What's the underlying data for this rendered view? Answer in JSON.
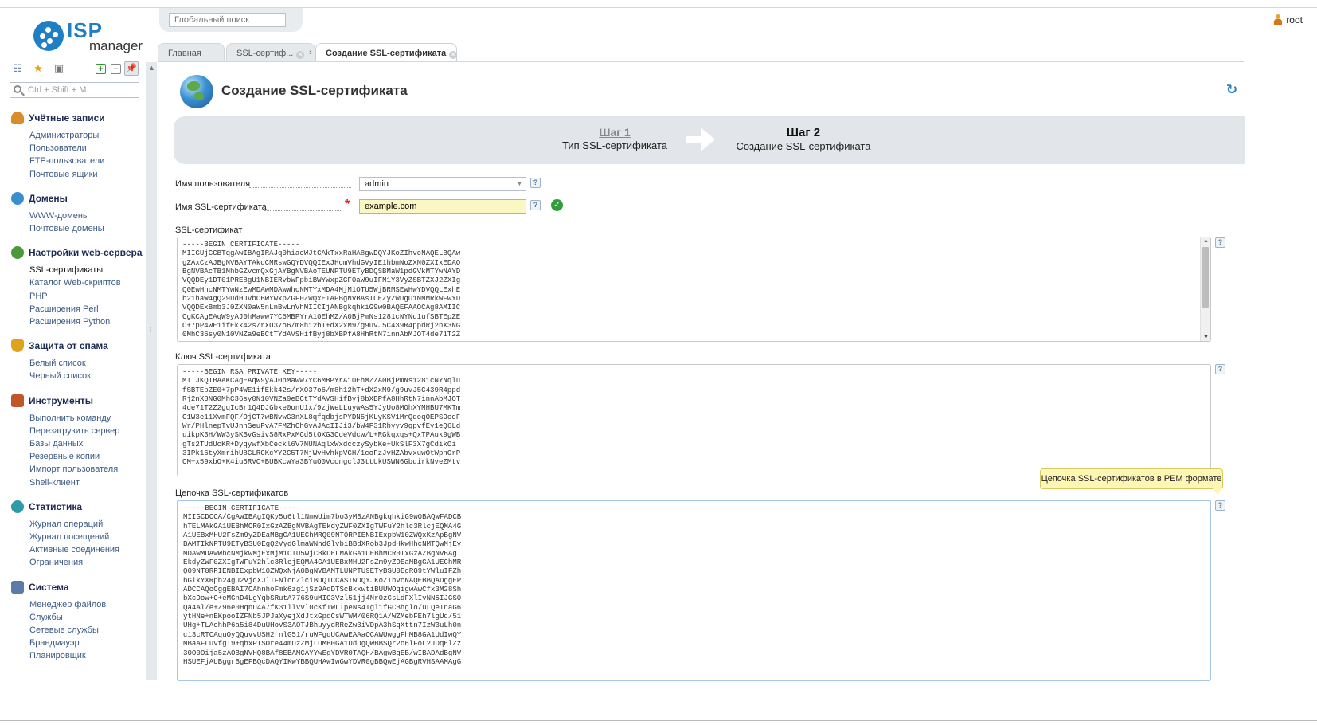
{
  "app": {
    "logo_main": "ISP",
    "logo_sub": "manager"
  },
  "header": {
    "search_placeholder": "Глобальный поиск",
    "user_name": "root"
  },
  "tabs": [
    {
      "label": "Главная"
    },
    {
      "label": "SSL-сертиф..."
    },
    {
      "label": "Создание SSL-сертификата"
    }
  ],
  "sidebar": {
    "search_placeholder": "Ctrl + Shift + M",
    "groups": [
      {
        "title": "Учётные записи",
        "icon": "user-icon",
        "color": "#d98c2b",
        "items": [
          "Администраторы",
          "Пользователи",
          "FTP-пользователи",
          "Почтовые ящики"
        ]
      },
      {
        "title": "Домены",
        "icon": "globe-icon",
        "color": "#3a8fd0",
        "items": [
          "WWW-домены",
          "Почтовые домены"
        ]
      },
      {
        "title": "Настройки web-сервера",
        "icon": "web-settings-icon",
        "color": "#4a9a3a",
        "items": [
          "SSL-сертификаты",
          "Каталог Web-скриптов",
          "PHP",
          "Расширения Perl",
          "Расширения Python"
        ]
      },
      {
        "title": "Защита от спама",
        "icon": "shield-icon",
        "color": "#e0a21d",
        "items": [
          "Белый список",
          "Черный список"
        ]
      },
      {
        "title": "Инструменты",
        "icon": "tools-icon",
        "color": "#c0562a",
        "items": [
          "Выполнить команду",
          "Перезагрузить сервер",
          "Базы данных",
          "Резервные копии",
          "Импорт пользователя",
          "Shell-клиент"
        ]
      },
      {
        "title": "Статистика",
        "icon": "stats-icon",
        "color": "#2f9aa8",
        "items": [
          "Журнал операций",
          "Журнал посещений",
          "Активные соединения",
          "Ограничения"
        ]
      },
      {
        "title": "Система",
        "icon": "system-icon",
        "color": "#5a7aa8",
        "items": [
          "Менеджер файлов",
          "Службы",
          "Сетевые службы",
          "Брандмауэр",
          "Планировщик"
        ]
      }
    ]
  },
  "page": {
    "title": "Создание SSL-сертификата",
    "step1": {
      "title": "Шаг 1",
      "desc": "Тип SSL-сертификата"
    },
    "step2": {
      "title": "Шаг 2",
      "desc": "Создание SSL-сертификата"
    }
  },
  "form": {
    "username_label": "Имя пользователя",
    "username_value": "admin",
    "certname_label": "Имя SSL-сертификата",
    "certname_value": "example.com",
    "cert_label": "SSL-сертификат",
    "cert_text": "-----BEGIN CERTIFICATE-----\nMIIGUjCCBTqgAwIBAgIRAJq0hiaeWJtCAkTxxRaHA8gwDQYJKoZIhvcNAQELBQAw\ngZAxCzAJBgNVBAYTAkdCMRswGQYDVQQIExJHcmVhdGVyIE1hbmNoZXN0ZXIxEDAO\nBgNVBAcTB1NhbGZvcmQxGjAYBgNVBAoTEUNPTU9ETyBDQSBMaW1pdGVkMTYwNAYD\nVQQDEy1DT01PRE8gU1NBIERvbWFpbiBWYWxpZGF0aW9uIFN1Y3VyZSBTZXJ2ZXIg\nQ0EwHhcNMTYwNzEwMDAwMDAwWhcNMTYxMDA4MjM1OTU5WjBRMSEwHwYDVQQLExhE\nb21haW4gQ29udHJvbCBWYWxpZGF0ZWQxETAPBgNVBAsTCEZyZWUgU1NMMRkwFwYD\nVQQDExBmb3J0ZXN0aW5nLnBwLnVhMIICIjANBgkqhkiG9w0BAQEFAAOCAg8AMIIC\nCgKCAgEAqW9yAJ0hMaww7YC6MBPYrA10EhMZ/A0BjPmNs1281cNYNq1ufSBTEpZE\nO+7pP4WE1ifEkk42s/rXO37o6/m8h12hT+dX2xM9/g9uvJ5C439R4ppdRj2nX3NG\n0MhC36sy0N10VNZa9eBCtTYdAVSHifByj8bXBPfA8HhRtN7innAbMJOT4de71T2Z",
    "key_label": "Ключ SSL-сертификата",
    "key_text": "-----BEGIN RSA PRIVATE KEY-----\nMIIJKQIBAAKCAgEAqW9yAJ0hMaww7YC6MBPYrA10EhMZ/A0BjPmNs1281cNYNqlu\nfSBTEpZE0+7pP4WE1ifEkk42s/rXO37o6/m8h12hT+dX2xM9/g9uvJ5C439R4ppd\nRj2nX3NG0MhC36sy0N10VNZa9eBCtTYdAVSHifByj8bXBPfA8HhRtN7innAbMJOT\n4de71T2Z2gqIcBr1Q4DJGbke0onU1x/9zjWeLLuywAs5YJyUo8MOhXYMHBU7MKTm\nC1W3e11XvmFQF/OjCT7wBNvwG3nXL8qfqdbjsPYDN5jKLyKSV1MrQdoqOEPSOcdF\nWr/PHlnepTvUJnhSeuPvA7FMZhChGvAJAcIIJi3/bW4F31Rhyyv9gpvfEy1eQ6Ld\nuikpK3H/WW3ySKBvGsivS8RxPxMCd5tOXG3CdeVdcw/L+RGkqxqs+QxTPAuk9gWB\ngTs2TUdUcKR+DyqywfXbCeckl6V7NUNAqlxWxdcczySybKe+UkSlF3X7gCdikOi\n3IPk16tyXmrihU8GLRCKcYY2C5T7NjWvHvhkpVGH/1coFzJvHZAbvxuwOtWpnOrP\nCM+x59xbO+K4iu5RVC+BUBKcwYa3BYuO0VccngclJ3ttUkUSWN6GbqirkNveZMtv",
    "chain_label": "Цепочка SSL-сертификатов",
    "chain_text": "-----BEGIN CERTIFICATE-----\nMIIGCDCCA/CgAwIBAgIQKy5u6tl1NmwUim7bo3yMBzANBgkqhkiG9w0BAQwFADCB\nhTELMAkGA1UEBhMCR0IxGzAZBgNVBAgTEkdyZWF0ZXIgTWFuY2hlc3RlcjEQMA4G\nA1UEBxMHU2FsZm9yZDEaMBgGA1UEChMRQ09NT0RPIENBIExpbW10ZWQxKzApBgNV\nBAMTIkNPTU9ETyBSU0EgQ2VydGlmaWNhdGlvbiBBdXRob3JpdHkwHhcNMTQwMjEy\nMDAwMDAwWhcNMjkwMjExMjM1OTU5WjCBkDELMAkGA1UEBhMCR0IxGzAZBgNVBAgT\nEkdyZWF0ZXIgTWFuY2hlc3RlcjEQMA4GA1UEBxMHU2FsZm9yZDEaMBgGA1UEChMR\nQ09NT0RPIENBIExpbW10ZWQxNjA0BgNVBAMTLUNPTU9ETyBSU0EgRG9tYWluIFZh\nbGlkYXRpb24gU2VjdXJlIFNlcnZlciBDQTCCASIwDQYJKoZIhvcNAQEBBQADggEP\nADCCAQoCggEBAI7CAhnhoFmk6zg1jSz9AdDTScBkxwtiBUUWOqigwAwCfx3M28Sh\nbXcDow+G+eMGnD4LgYqbSRutA776S9uMIO3Vzl51jj4Nr0zCsLdFXlIvNN5IJGS0\nQa4Al/e+Z96e0HqnU4A7fK31llVvl0cKfIWLIpeNs4Tgl1fGCBhglo/uLQeTnaG6\nytHNe+nEKpooIZFNb5JPJaXyejXdJtxGpdCsWTWM/06RQ1A/WZMebFEh7lgUq/51\nUHg+TLAchhP6a5i84DuUHoVS3AOTJBhuyydRReZw3iVDpA3hSqXttn7IzW3uLh0n\nc13cRTCAquOyQQuvvUSH2rnlG51/ruWFgqUCAwEAAaOCAWUwggFhMB8GA1UdIwQY\nMBaAFLuvfgI9+qbxPISOre44mOzZMjLUMB0GA1UdDgQWBBSQr2o6lFoL2JDqElZz\n30O0Oija5zAOBgNVHQ8BAf8EBAMCAYYwEgYDVR0TAQH/BAgwBgEB/wIBADAdBgNV\nHSUEFjAUBggrBgEFBQcDAQYIKwYBBQUHAwIwGwYDVR0gBBQwEjAGBgRVHSAAMAgG",
    "tooltip": "Цепочка SSL-сертификатов в PEM формате"
  }
}
